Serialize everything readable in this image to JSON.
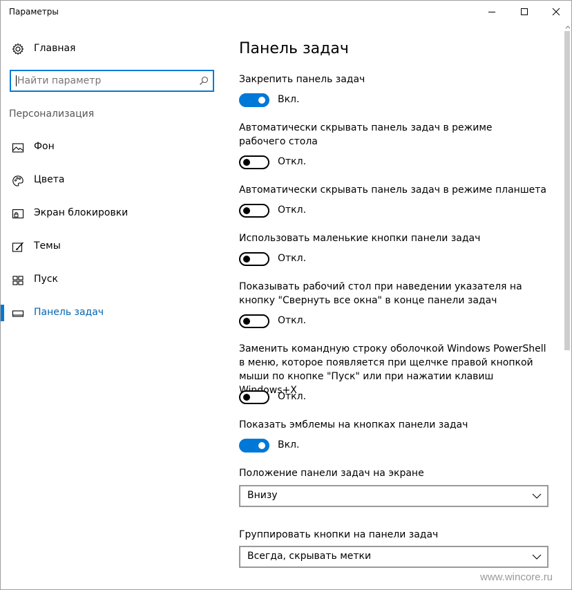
{
  "window": {
    "title": "Параметры"
  },
  "sidebar": {
    "home_label": "Главная",
    "search_placeholder": "Найти параметр",
    "section": "Персонализация",
    "items": [
      {
        "label": "Фон",
        "icon": "image-icon"
      },
      {
        "label": "Цвета",
        "icon": "palette-icon"
      },
      {
        "label": "Экран блокировки",
        "icon": "lock-screen-icon"
      },
      {
        "label": "Темы",
        "icon": "brush-icon"
      },
      {
        "label": "Пуск",
        "icon": "start-grid-icon"
      },
      {
        "label": "Панель задач",
        "icon": "taskbar-icon",
        "active": true
      }
    ]
  },
  "main": {
    "title": "Панель задач",
    "settings": [
      {
        "label": "Закрепить панель задач",
        "state": "Вкл.",
        "on": true
      },
      {
        "label": "Автоматически скрывать панель задач в режиме рабочего стола",
        "state": "Откл.",
        "on": false
      },
      {
        "label": "Автоматически скрывать панель задач в режиме планшета",
        "state": "Откл.",
        "on": false
      },
      {
        "label": "Использовать маленькие кнопки панели задач",
        "state": "Откл.",
        "on": false
      },
      {
        "label": "Показывать рабочий стол при наведении указателя на кнопку \"Свернуть все окна\" в конце панели задач",
        "state": "Откл.",
        "on": false
      },
      {
        "label": "Заменить командную строку оболочкой Windows PowerShell в меню, которое появляется при щелчке правой кнопкой мыши по кнопке \"Пуск\" или при нажатии клавиш Windows+X",
        "state": "Откл.",
        "on": false
      },
      {
        "label": "Показать эмблемы на кнопках панели задач",
        "state": "Вкл.",
        "on": true
      }
    ],
    "position_label": "Положение панели задач на экране",
    "position_value": "Внизу",
    "group_label": "Группировать кнопки на панели задач",
    "group_value": "Всегда, скрывать метки"
  },
  "watermark": "www.wincore.ru",
  "colors": {
    "accent": "#0078d7",
    "active_text": "#0063b1"
  }
}
